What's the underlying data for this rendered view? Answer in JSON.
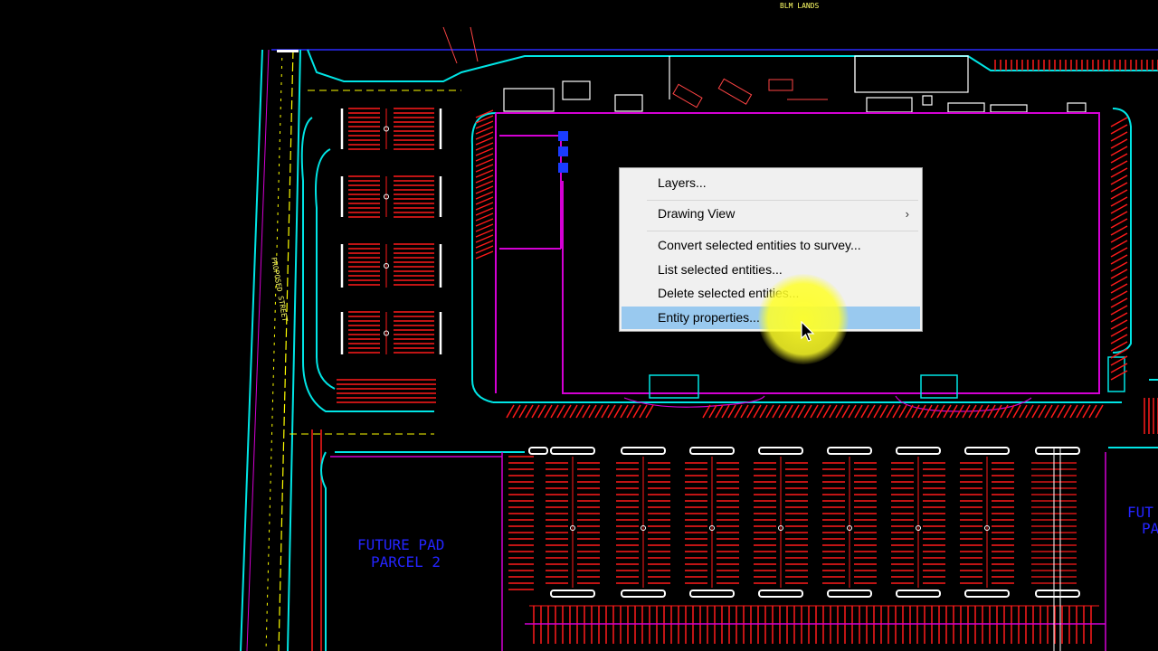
{
  "drawing": {
    "top_label": "BLM LANDS",
    "street_label": "PROPOSED STREET",
    "pad_label_line1": "FUTURE PAD",
    "pad_label_line2": "PARCEL 2",
    "right_pad_label_line1": "FUT",
    "right_pad_label_line2": "PA"
  },
  "context_menu": {
    "items": [
      {
        "label": "Layers..."
      },
      {
        "label": "Drawing View",
        "submenu_icon": "chevron-right-icon"
      },
      {
        "label": "Convert selected entities to survey..."
      },
      {
        "label": "List selected entities..."
      },
      {
        "label": "Delete selected entities..."
      },
      {
        "label": "Entity properties...",
        "highlighted": true
      }
    ],
    "submenu_glyph": "›"
  },
  "colors": {
    "background": "#000000",
    "curb": "#00e5e5",
    "parking": "#ff1a1a",
    "building": "#d400d4",
    "road_center": "#ffff00",
    "label": "#2222ff",
    "menu_bg": "#f0f0f0",
    "menu_highlight": "#99c9ef",
    "cursor_highlight": "#ffff33"
  }
}
